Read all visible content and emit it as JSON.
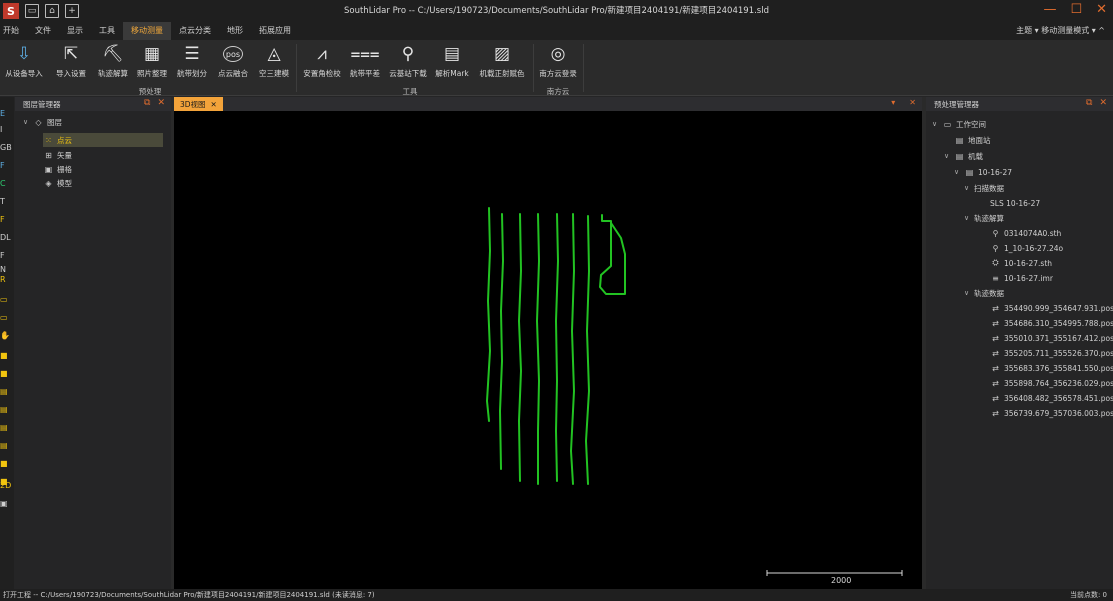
{
  "titlebar": {
    "title": "SouthLidar Pro -- C:/Users/190723/Documents/SouthLidar Pro/新建项目2404191/新建项目2404191.sld",
    "logo_letter": "S",
    "quick_icons": [
      "save-icon",
      "open-icon",
      "new-icon"
    ]
  },
  "menu": {
    "items": [
      "开始",
      "文件",
      "显示",
      "工具",
      "移动测量",
      "点云分类",
      "地形",
      "拓展应用"
    ],
    "active": "移动测量",
    "right": "主题 ▾  移动测量模式 ▾  ^"
  },
  "ribbon": {
    "buttons": [
      {
        "label": "从设备导入",
        "icon": "import-device-icon",
        "glyph": "⇩"
      },
      {
        "label": "导入设置",
        "icon": "import-settings-icon",
        "glyph": "⇱"
      },
      {
        "label": "轨迹解算",
        "icon": "trajectory-solve-icon",
        "glyph": "⛏"
      },
      {
        "label": "照片整理",
        "icon": "photo-organize-icon",
        "glyph": "▦"
      },
      {
        "label": "航带划分",
        "icon": "strip-split-icon",
        "glyph": "☰"
      },
      {
        "label": "点云融合",
        "icon": "pointcloud-merge-icon",
        "glyph": "pos"
      },
      {
        "label": "空三建模",
        "icon": "aerial-model-icon",
        "glyph": "◬"
      },
      {
        "label": "安置角检校",
        "icon": "boresight-calibrate-icon",
        "glyph": "⩘"
      },
      {
        "label": "航带平差",
        "icon": "strip-adjust-icon",
        "glyph": "⩶"
      },
      {
        "label": "云基站下载",
        "icon": "base-station-download-icon",
        "glyph": "⚲"
      },
      {
        "label": "解析Mark",
        "icon": "parse-mark-icon",
        "glyph": "▤"
      },
      {
        "label": "机载正射赋色",
        "icon": "ortho-color-icon",
        "glyph": "▨"
      },
      {
        "label": "南方云登录",
        "icon": "cloud-login-icon",
        "glyph": "◎"
      }
    ],
    "groups": [
      "预处理",
      "工具",
      "南方云"
    ]
  },
  "toolstrip": {
    "items": [
      "E",
      "I",
      "GB",
      "F",
      "C",
      "T",
      "F",
      "DL",
      "F",
      "N",
      "R",
      "▭",
      "▭",
      "✋",
      "■",
      "■",
      "▤",
      "▤",
      "▤",
      "▤",
      "■",
      "■",
      "2D",
      "▣"
    ]
  },
  "layer_panel": {
    "title": "图层管理器",
    "root": "图层",
    "items": [
      {
        "label": "点云",
        "icon": "pointcloud-icon",
        "selected": true
      },
      {
        "label": "矢量",
        "icon": "vector-icon",
        "selected": false
      },
      {
        "label": "栅格",
        "icon": "raster-icon",
        "selected": false
      },
      {
        "label": "模型",
        "icon": "model-icon",
        "selected": false
      }
    ]
  },
  "view": {
    "tab_label": "3D视图",
    "scale_label": "2000"
  },
  "preprocess_panel": {
    "title": "预处理管理器",
    "workspace": "工作空间",
    "ground_station": "地面站",
    "airborne": "机载",
    "dataset": "10-16-27",
    "scan_data_label": "扫描数据",
    "scan_items": [
      "SLS 10-16-27"
    ],
    "traj_solve_label": "轨迹解算",
    "traj_solve_items": [
      "0314074A0.sth",
      "1_10-16-27.24o",
      "10-16-27.sth",
      "10-16-27.imr"
    ],
    "traj_data_label": "轨迹数据",
    "traj_data_items": [
      "354490.999_354647.931.pos",
      "354686.310_354995.788.pos",
      "355010.371_355167.412.pos",
      "355205.711_355526.370.pos",
      "355683.376_355841.550.pos",
      "355898.764_356236.029.pos",
      "356408.482_356578.451.pos",
      "356739.679_357036.003.pos"
    ]
  },
  "statusbar": {
    "text": "打开工程 -- C:/Users/190723/Documents/SouthLidar Pro/新建项目2404191/新建项目2404191.sld (未读消息: 7)",
    "right": "当前点数: 0"
  },
  "colors": {
    "accent": "#f3a33a",
    "trajectory": "#22c322",
    "background": "#000000"
  }
}
